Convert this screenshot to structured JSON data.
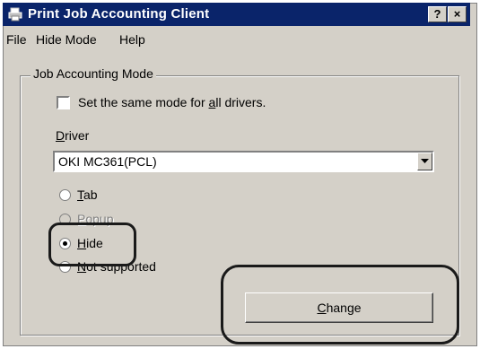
{
  "window": {
    "title": "Print Job Accounting Client",
    "help_button": "?",
    "close_button": "×"
  },
  "menu": {
    "items": [
      {
        "label": "File"
      },
      {
        "label": "Hide Mode"
      },
      {
        "label": "Help"
      }
    ]
  },
  "group": {
    "label": "Job Accounting Mode",
    "checkbox": {
      "label_before": "Set the same mode for ",
      "label_underlined": "a",
      "label_after": "ll drivers.",
      "checked": false
    },
    "driver_label": {
      "underlined": "D",
      "rest": "river"
    },
    "driver_select": {
      "value": "OKI MC361(PCL)"
    },
    "modes": [
      {
        "underlined": "T",
        "rest": "ab",
        "selected": false,
        "enabled": true
      },
      {
        "underlined": "P",
        "rest": "opup",
        "selected": false,
        "enabled": false
      },
      {
        "underlined": "H",
        "rest": "ide",
        "selected": true,
        "enabled": true
      },
      {
        "underlined": "N",
        "rest": "ot supported",
        "selected": false,
        "enabled": true
      }
    ],
    "change_button": {
      "underlined": "C",
      "rest": "hange"
    }
  },
  "colors": {
    "titlebar": "#0a246a",
    "face": "#d4d0c8",
    "highlight_outline": "#1a1a1a"
  }
}
